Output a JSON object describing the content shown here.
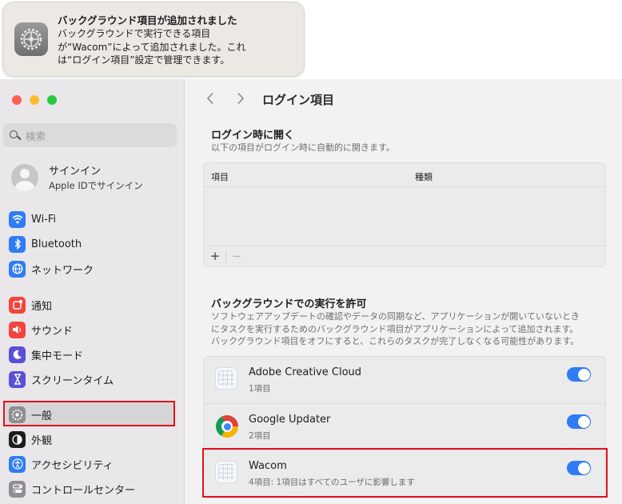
{
  "notification": {
    "title": "バックグラウンド項目が追加されました",
    "body_lines": [
      "バックグラウンドで実行できる項目",
      "が“Wacom”によって追加されました。これ",
      "は“ログイン項目”設定で管理できます。"
    ],
    "icon": "gear-icon"
  },
  "sidebar": {
    "search_placeholder": "検索",
    "account": {
      "name": "サインイン",
      "subtitle": "Apple IDでサインイン"
    },
    "items": [
      {
        "label": "Wi-Fi",
        "icon": "wifi-icon",
        "color": "#2f7cf6"
      },
      {
        "label": "Bluetooth",
        "icon": "bluetooth-icon",
        "color": "#2f7cf6"
      },
      {
        "label": "ネットワーク",
        "icon": "globe-icon",
        "color": "#2f7cf6"
      },
      {
        "label": "通知",
        "icon": "bell-icon",
        "color": "#f2453d"
      },
      {
        "label": "サウンド",
        "icon": "speaker-icon",
        "color": "#f2453d"
      },
      {
        "label": "集中モード",
        "icon": "moon-icon",
        "color": "#5b4fd6"
      },
      {
        "label": "スクリーンタイム",
        "icon": "hourglass-icon",
        "color": "#5b4fd6"
      },
      {
        "label": "一般",
        "icon": "gear-icon",
        "color": "#8e8e93",
        "selected": true
      },
      {
        "label": "外観",
        "icon": "appearance-icon",
        "color": "#1d1d1f"
      },
      {
        "label": "アクセシビリティ",
        "icon": "accessibility-icon",
        "color": "#2f7cf6"
      },
      {
        "label": "コントロールセンター",
        "icon": "control-center-icon",
        "color": "#8e8e93"
      }
    ]
  },
  "main": {
    "title": "ログイン項目",
    "login": {
      "title": "ログイン時に開く",
      "subtitle": "以下の項目がログイン時に自動的に開きます。",
      "col_item": "項目",
      "col_kind": "種類",
      "add": "+",
      "remove": "−"
    },
    "background": {
      "title": "バックグラウンドでの実行を許可",
      "subtitle_lines": [
        "ソフトウェアアップデートの確認やデータの同期など、アプリケーションが開いていないとき",
        "にタスクを実行するためのバックグラウンド項目がアプリケーションによって追加されます。",
        "バックグラウンド項目をオフにすると、これらのタスクが完了しなくなる可能性があります。"
      ],
      "apps": [
        {
          "name": "Adobe Creative Cloud",
          "count": "1項目",
          "enabled": true,
          "icon": "generic-app-icon"
        },
        {
          "name": "Google Updater",
          "count": "2項目",
          "enabled": true,
          "icon": "chrome-icon"
        },
        {
          "name": "Wacom",
          "count": "4項目: 1項目はすべてのユーザに影響します",
          "enabled": true,
          "icon": "generic-app-icon"
        }
      ]
    }
  }
}
